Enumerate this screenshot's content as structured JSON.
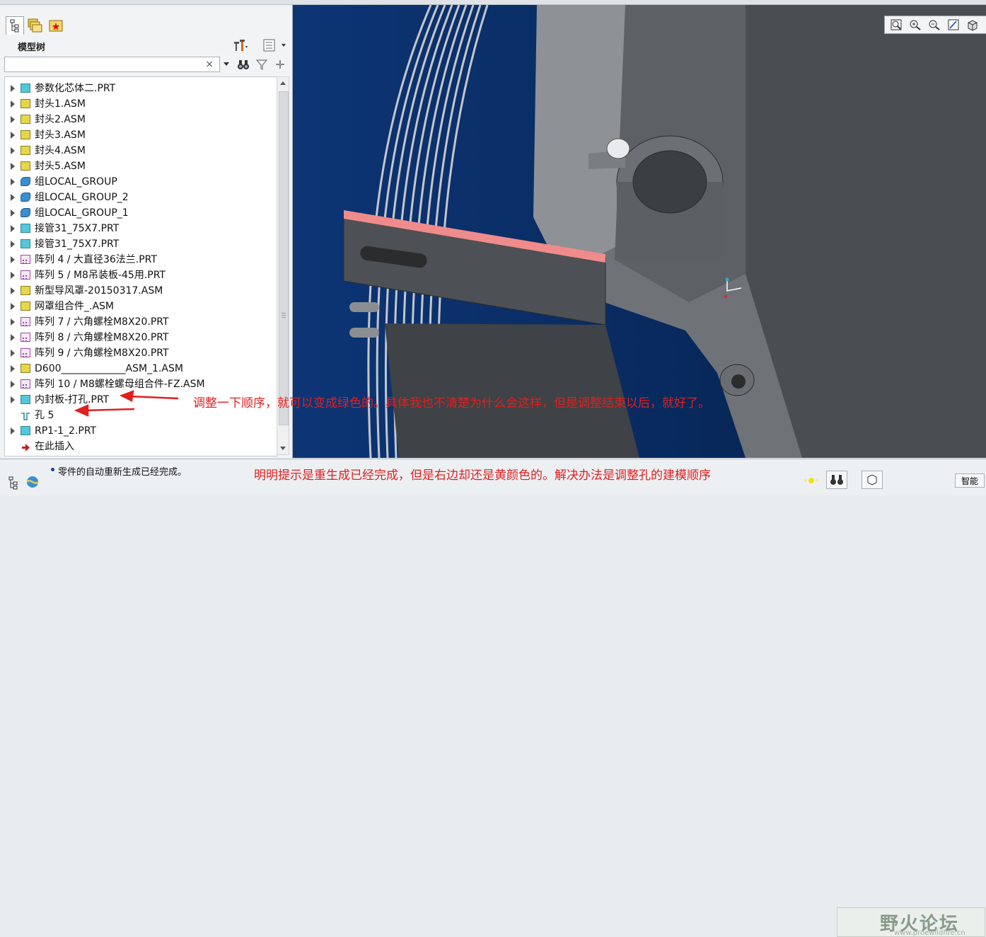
{
  "panel": {
    "title": "模型树",
    "search": {
      "value": "",
      "placeholder": ""
    },
    "clear_glyph": "×"
  },
  "tree": {
    "items": [
      {
        "label": "参数化芯体二.PRT",
        "icon": "part-icon",
        "expandable": true
      },
      {
        "label": "封头1.ASM",
        "icon": "assembly-icon",
        "expandable": true
      },
      {
        "label": "封头2.ASM",
        "icon": "assembly-icon",
        "expandable": true
      },
      {
        "label": "封头3.ASM",
        "icon": "assembly-icon",
        "expandable": true
      },
      {
        "label": "封头4.ASM",
        "icon": "assembly-icon",
        "expandable": true
      },
      {
        "label": "封头5.ASM",
        "icon": "assembly-icon",
        "expandable": true
      },
      {
        "label": "组LOCAL_GROUP",
        "icon": "group-icon",
        "expandable": true
      },
      {
        "label": "组LOCAL_GROUP_2",
        "icon": "group-icon",
        "expandable": true
      },
      {
        "label": "组LOCAL_GROUP_1",
        "icon": "group-icon",
        "expandable": true
      },
      {
        "label": "接管31_75X7.PRT",
        "icon": "part-icon",
        "expandable": true
      },
      {
        "label": "接管31_75X7.PRT",
        "icon": "part-icon",
        "expandable": true
      },
      {
        "label": "阵列 4 / 大直径36法兰.PRT",
        "icon": "pattern-icon",
        "expandable": true
      },
      {
        "label": "阵列 5 / M8吊装板-45用.PRT",
        "icon": "pattern-icon",
        "expandable": true
      },
      {
        "label": "新型导风罩-20150317.ASM",
        "icon": "assembly-icon",
        "expandable": true
      },
      {
        "label": "网罩组合件_.ASM",
        "icon": "assembly-icon",
        "expandable": true
      },
      {
        "label": "阵列 7 / 六角螺栓M8X20.PRT",
        "icon": "pattern-icon",
        "expandable": true
      },
      {
        "label": "阵列 8 / 六角螺栓M8X20.PRT",
        "icon": "pattern-icon",
        "expandable": true
      },
      {
        "label": "阵列 9 / 六角螺栓M8X20.PRT",
        "icon": "pattern-icon",
        "expandable": true
      },
      {
        "label": "D600_____________ASM_1.ASM",
        "icon": "assembly-icon",
        "expandable": true
      },
      {
        "label": "阵列 10 / M8螺栓螺母组合件-FZ.ASM",
        "icon": "pattern-icon",
        "expandable": true
      },
      {
        "label": "内封板-打孔.PRT",
        "icon": "part-icon",
        "expandable": true
      },
      {
        "label": "孔 5",
        "icon": "hole-feature-icon",
        "expandable": false
      },
      {
        "label": "RP1-1_2.PRT",
        "icon": "part-icon",
        "expandable": true
      },
      {
        "label": "在此插入",
        "icon": "insert-here-arrow-icon",
        "expandable": false
      }
    ]
  },
  "annotations": {
    "tree_note": "调整一下顺序，就可以变成绿色的。具体我也不清楚为什么会这样，但是调整结束以后，就好了。",
    "status_note": "明明提示是重生成已经完成，但是右边却还是黄颜色的。解决办法是调整孔的建模顺序"
  },
  "status": {
    "message": "零件的自动重新生成已经完成。",
    "smart_filter": "智能"
  },
  "watermark": {
    "title": "野火论坛",
    "subtitle": "www.proewildfire.cn"
  },
  "colors": {
    "viewport_bg": "#0b2f66",
    "highlight": "#f08b8b",
    "annotation": "#e02020",
    "regen_indicator": "#f2e21a"
  }
}
